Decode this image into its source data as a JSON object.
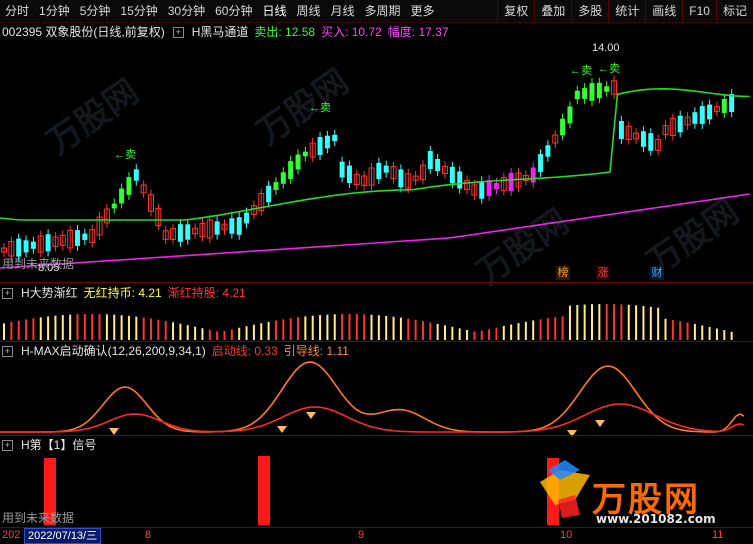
{
  "toolbar": {
    "periods": [
      "分时",
      "1分钟",
      "5分钟",
      "15分钟",
      "30分钟",
      "60分钟",
      "日线",
      "周线",
      "月线",
      "多周期",
      "更多"
    ],
    "actions": [
      "复权",
      "叠加",
      "多股",
      "统计",
      "画线",
      "F10",
      "标记"
    ]
  },
  "main_panel": {
    "code_title": "002395 双象股份(日线,前复权)",
    "indicator_name": "H黑马通道",
    "sell_label": "卖出: 12.58",
    "buy_label": "买入: 10.72",
    "amp_label": "幅度: 17.37",
    "high_price": "14.00",
    "low_price": "8.05",
    "sell_marks": [
      "卖",
      "卖",
      "卖",
      "卖"
    ],
    "badges": [
      "榜",
      "涨",
      "财"
    ],
    "future_note": "用到未来数据"
  },
  "panel2": {
    "title": "H大势渐红",
    "label1": "无红持币: 4.21",
    "label2": "渐红持股: 4.21"
  },
  "panel3": {
    "title": "H-MAX启动确认(12,26,200,9,34,1)",
    "label1": "启动线: 0.33",
    "label2": "引导线: 1.11"
  },
  "panel4": {
    "title": "H第【1】信号",
    "future_note": "用到未来数据"
  },
  "bottom": {
    "year_prefix": "202",
    "date": "2022/07/13/三",
    "month_labels": [
      "8",
      "9",
      "10",
      "11"
    ]
  },
  "logo": {
    "text": "万股网",
    "url": "www.201082.com"
  },
  "colors": {
    "up": "#ff3333",
    "down": "#33ffff",
    "signal_up": "#33ff33",
    "upper_band": "#22dd22",
    "lower_band": "#ee22ee",
    "orange": "#ff7a22",
    "red_line": "#ff2a2a"
  }
}
